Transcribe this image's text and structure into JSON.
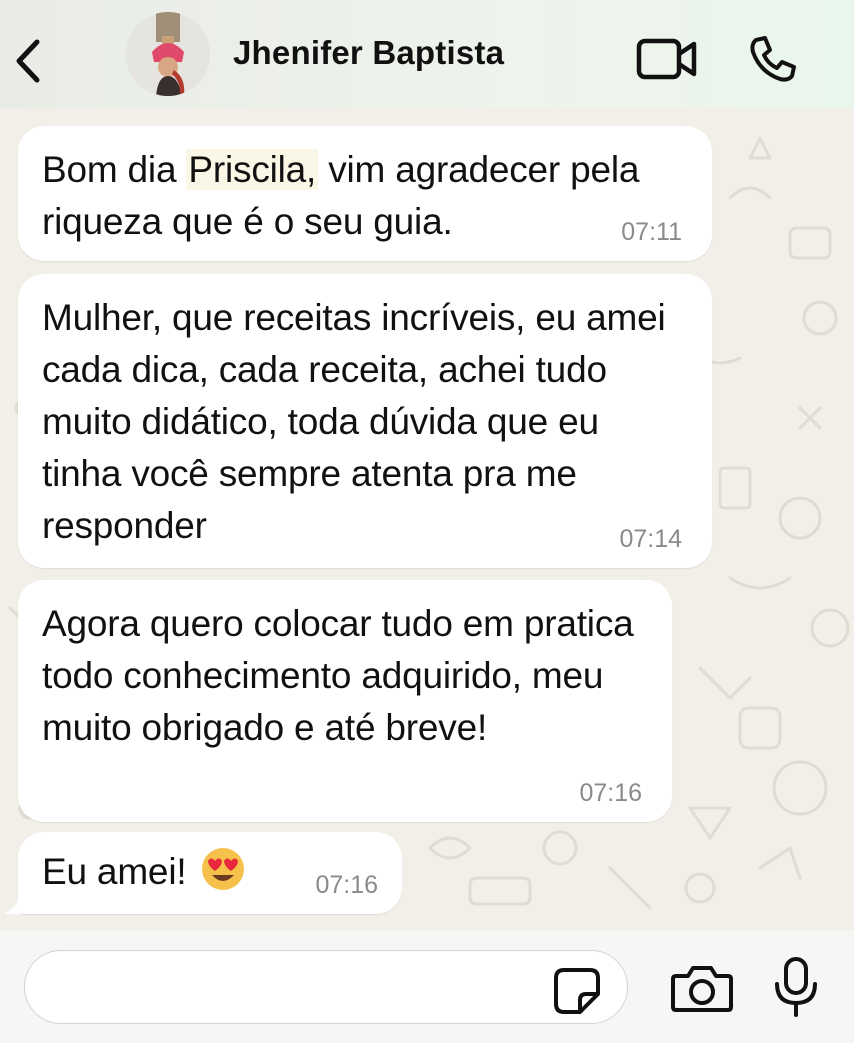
{
  "header": {
    "contact_name": "Jhenifer Baptista",
    "back_icon": "chevron-left-icon",
    "video_icon": "video-camera-icon",
    "call_icon": "phone-icon"
  },
  "messages": [
    {
      "text_before": "Bom dia ",
      "text_highlight": "Priscila,",
      "text_after": " vim agradecer pela riqueza que é o seu guia.",
      "time": "07:11"
    },
    {
      "text": "Mulher, que receitas incríveis, eu amei cada dica, cada receita, achei tudo muito didático, toda dúvida que eu tinha você sempre atenta pra me responder",
      "time": "07:14"
    },
    {
      "text": "Agora quero colocar tudo em pratica todo conhecimento adquirido, meu muito obrigado e até breve!",
      "time": "07:16"
    },
    {
      "text": "Eu amei!",
      "emoji": "heart-eyes-emoji",
      "time": "07:16"
    }
  ],
  "composer": {
    "input_value": "",
    "sticker_icon": "sticker-icon",
    "camera_icon": "camera-icon",
    "mic_icon": "microphone-icon"
  },
  "colors": {
    "wallpaper": "#f2efe8",
    "bubble": "#ffffff",
    "timestamp": "#8a8a8a"
  }
}
